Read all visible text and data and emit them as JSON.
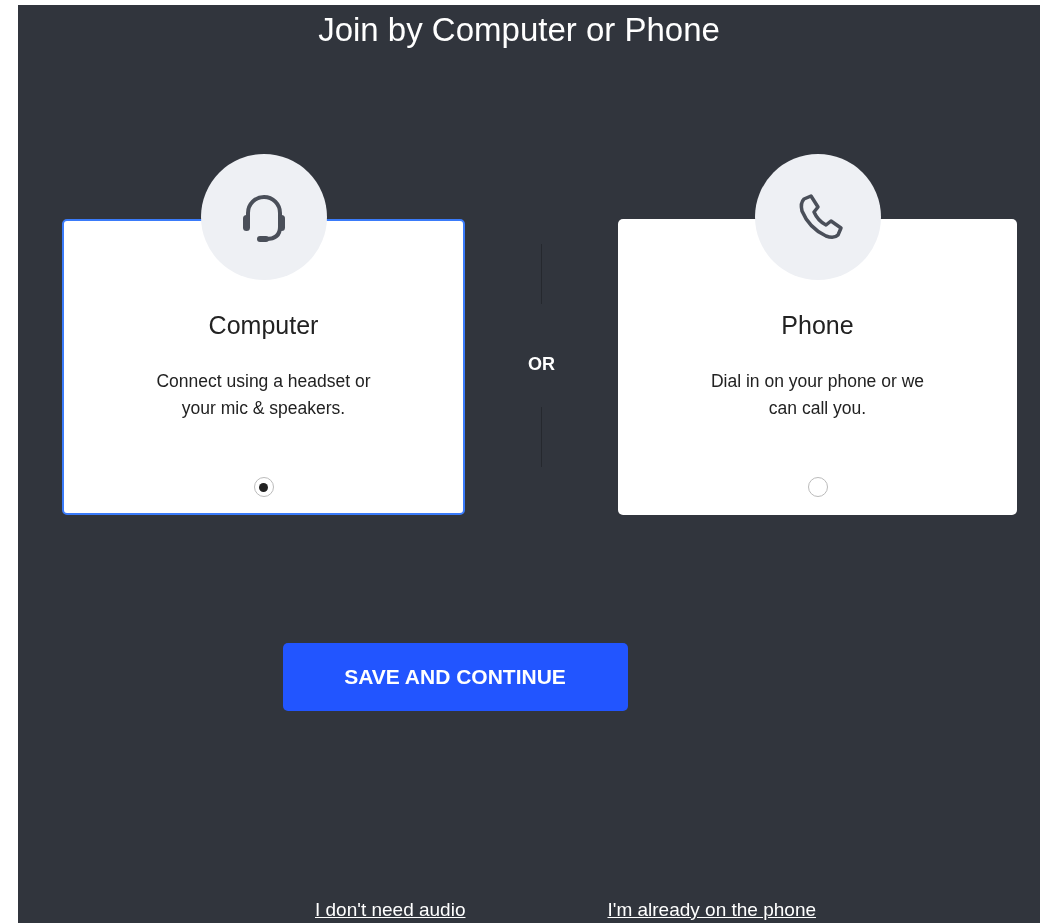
{
  "title": "Join by Computer or Phone",
  "options": [
    {
      "kind": "computer",
      "label": "Computer",
      "description": "Connect using a headset or your mic & speakers.",
      "selected": true
    },
    {
      "kind": "phone",
      "label": "Phone",
      "description": "Dial in on your phone or we can call you.",
      "selected": false
    }
  ],
  "separator": "OR",
  "primary_button": "SAVE AND CONTINUE",
  "links": [
    "I don't need audio",
    "I'm already on the phone"
  ]
}
